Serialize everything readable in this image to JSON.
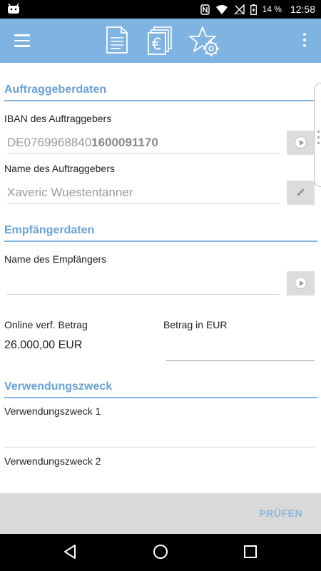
{
  "status_bar": {
    "battery_percent": "14 %",
    "time": "12:58"
  },
  "toolbar": {
    "menu_icon": "hamburger-icon",
    "icons": [
      "document-icon",
      "euro-documents-icon",
      "star-gear-icon"
    ],
    "overflow_icon": "kebab-icon"
  },
  "orderer": {
    "section_title": "Auftraggeberdaten",
    "iban_label": "IBAN des Auftraggebers",
    "iban_prefix": "DE0769968840",
    "iban_suffix": "1600091170",
    "name_label": "Name des Auftraggebers",
    "name_value": "Xaveric Wuestentanner"
  },
  "recipient": {
    "section_title": "Empfängerdaten",
    "name_label": "Name des Empfängers",
    "name_value": ""
  },
  "amount": {
    "available_label": "Online verf. Betrag",
    "available_value": "26.000,00 EUR",
    "amount_label": "Betrag in EUR",
    "amount_value": ""
  },
  "purpose": {
    "section_title": "Verwendungszweck",
    "line1_label": "Verwendungszweck 1",
    "line1_value": "",
    "line2_label": "Verwendungszweck 2",
    "line2_value": ""
  },
  "actions": {
    "check_label": "PRÜFEN"
  },
  "colors": {
    "accent": "#7fb3e2",
    "section_title": "#6aa2d6",
    "bottom_bar": "#d9d9d9"
  }
}
